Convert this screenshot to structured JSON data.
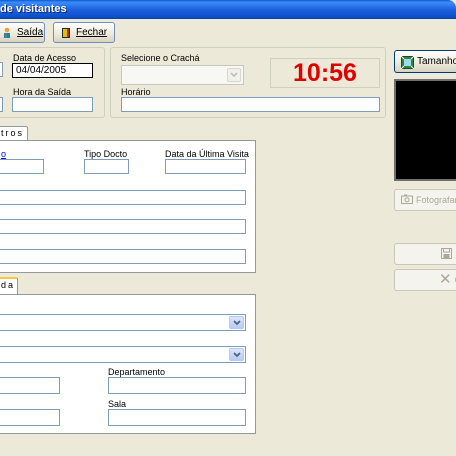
{
  "window": {
    "title": "de visitantes"
  },
  "toolbar": {
    "saida_label": "Saída",
    "fechar_label": "Fechar"
  },
  "access": {
    "data_acesso_label": "Data de Acesso",
    "data_acesso_value": "04/04/2005",
    "hora_saida_label": "Hora da Saída",
    "hora_saida_value": ""
  },
  "cracha": {
    "select_label": "Selecione o Crachá",
    "select_value": "",
    "horario_label": "Horário",
    "horario_value": "",
    "clock": "10:56"
  },
  "photo_panel": {
    "tamanho_label": "Tamanho",
    "fotografar_label": "Fotografar",
    "cancel_glyph": "C"
  },
  "visitor_panel": {
    "tab_label": "tros",
    "col1_label": "o",
    "tipo_docto_label": "Tipo Docto",
    "ultima_visita_label": "Data da Última Visita"
  },
  "visit_panel": {
    "tab_label": "da",
    "departamento_label": "Departamento",
    "sala_label": "Sala"
  },
  "colors": {
    "clock": "#e00000",
    "titlebar": "#1f62e0",
    "field_border": "#7f9db9"
  }
}
